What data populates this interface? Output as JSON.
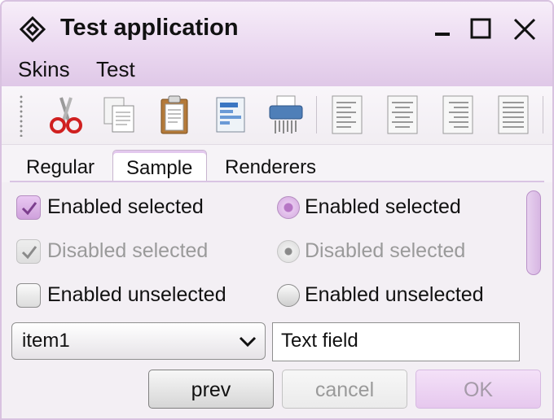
{
  "window": {
    "title": "Test application"
  },
  "menubar": {
    "items": [
      {
        "label": "Skins"
      },
      {
        "label": "Test"
      }
    ]
  },
  "toolbar": {
    "icons": [
      "cut-icon",
      "copy-icon",
      "paste-icon",
      "edit-document-icon",
      "shredder-icon",
      "align-left-icon",
      "align-center-icon",
      "align-right-icon",
      "align-justify-icon"
    ]
  },
  "tabs": [
    {
      "label": "Regular",
      "selected": false
    },
    {
      "label": "Sample",
      "selected": true
    },
    {
      "label": "Renderers",
      "selected": false
    }
  ],
  "checkboxes": [
    {
      "label": "Enabled selected",
      "checked": true,
      "enabled": true
    },
    {
      "label": "Disabled selected",
      "checked": true,
      "enabled": false
    },
    {
      "label": "Enabled unselected",
      "checked": false,
      "enabled": true
    }
  ],
  "radios": [
    {
      "label": "Enabled selected",
      "selected": true,
      "enabled": true
    },
    {
      "label": "Disabled selected",
      "selected": true,
      "enabled": false
    },
    {
      "label": "Enabled unselected",
      "selected": false,
      "enabled": true
    }
  ],
  "combo": {
    "value": "item1"
  },
  "textfield": {
    "value": "Text field"
  },
  "buttons": {
    "prev": {
      "label": "prev",
      "enabled": true
    },
    "cancel": {
      "label": "cancel",
      "enabled": false
    },
    "ok": {
      "label": "OK",
      "enabled": false
    }
  },
  "colors": {
    "accent": "#d8b4e4",
    "titlebar": "#e9d6ef",
    "disabled_text": "#9a9a9a"
  }
}
